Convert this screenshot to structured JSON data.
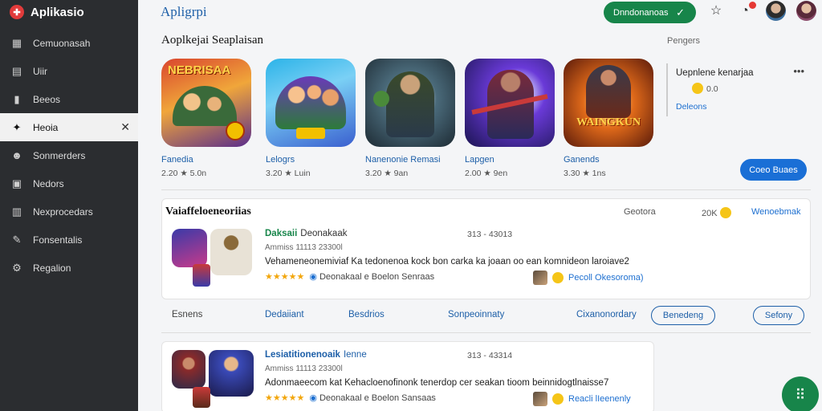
{
  "sidebar": {
    "brand": "Aplikasio",
    "items": [
      {
        "label": "Cemuonasah",
        "icon": "grid-icon"
      },
      {
        "label": "Uiir",
        "icon": "apps-icon"
      },
      {
        "label": "Beeos",
        "icon": "book-icon"
      },
      {
        "label": "Heoia",
        "icon": "games-icon",
        "active": true
      },
      {
        "label": "Sonmerders",
        "icon": "people-icon"
      },
      {
        "label": "Nedors",
        "icon": "news-icon"
      },
      {
        "label": "Nexprocedars",
        "icon": "chart-icon"
      },
      {
        "label": "Fonsentalis",
        "icon": "tool-icon"
      },
      {
        "label": "Regalion",
        "icon": "settings-icon"
      }
    ]
  },
  "header": {
    "title": "Apligrpi",
    "download_label": "Dnndonanoas",
    "notification_count": ""
  },
  "featured": {
    "title": "Aoplkejai Seaplaisan",
    "apps": [
      {
        "name": "Fanedia",
        "meta": "2.20 ★ 5.0n",
        "art": "NEBRISAA"
      },
      {
        "name": "Lelogrs",
        "meta": "3.20 ★ Luin",
        "art": ""
      },
      {
        "name": "Nanenonie Remasi",
        "meta": "3.20 ★ 9an",
        "art": ""
      },
      {
        "name": "Lapgen",
        "meta": "2.00 ★ 9en",
        "art": ""
      },
      {
        "name": "Ganends",
        "meta": "3.30 ★ 1ns",
        "art": "WAINGKUN"
      }
    ]
  },
  "promo": {
    "label": "Pengers",
    "title": "Uepnlene kenarjaa",
    "rating": "0.0",
    "link": "Deleons",
    "button": "Coeo Buaes"
  },
  "reviews": {
    "title": "Vaiaffeloeneoriias",
    "label": "Geotora",
    "count": "20K",
    "link": "Wenoebmak",
    "items": [
      {
        "author": "Daksaii",
        "tag": "Deonakaak",
        "date": "313 - 43013",
        "sub": "Ammiss 11113 23300l",
        "text": "Vehameneonemiviaf Ka tedonenoa kock bon carka ka joaan oo ean komnideon laroiave2",
        "stars": "★★★★★",
        "source": "Deonakaal e Boelon",
        "source_tag": "Senraas",
        "user": "Pecoll Okesoroma)"
      },
      {
        "author": "Lesiatitionenoaik",
        "tag": "Ienne",
        "date": "313 - 43314",
        "sub": "Ammiss 11113 23300l",
        "text": "Adonmaeecom kat Kehacloenofinonk tenerdop cer seakan tioom beinnidogtlnaisse7",
        "stars": "★★★★★",
        "source": "Deonakaal e Boelon",
        "source_tag": "Sansaas",
        "user": "Reacli lIeenenly"
      }
    ]
  },
  "tabs": [
    {
      "label": "Esnens"
    },
    {
      "label": "Dedaiiant"
    },
    {
      "label": "Besdrios"
    },
    {
      "label": "Sonpeoinnaty"
    },
    {
      "label": "Cixanonordary"
    }
  ],
  "tab_pills": [
    {
      "label": "Benedeng"
    },
    {
      "label": "Sefony"
    }
  ],
  "colors": {
    "sidebar_bg": "#2b2d30",
    "accent_green": "#17854a",
    "accent_blue": "#1a6fd6",
    "link_blue": "#1d5fa8"
  }
}
